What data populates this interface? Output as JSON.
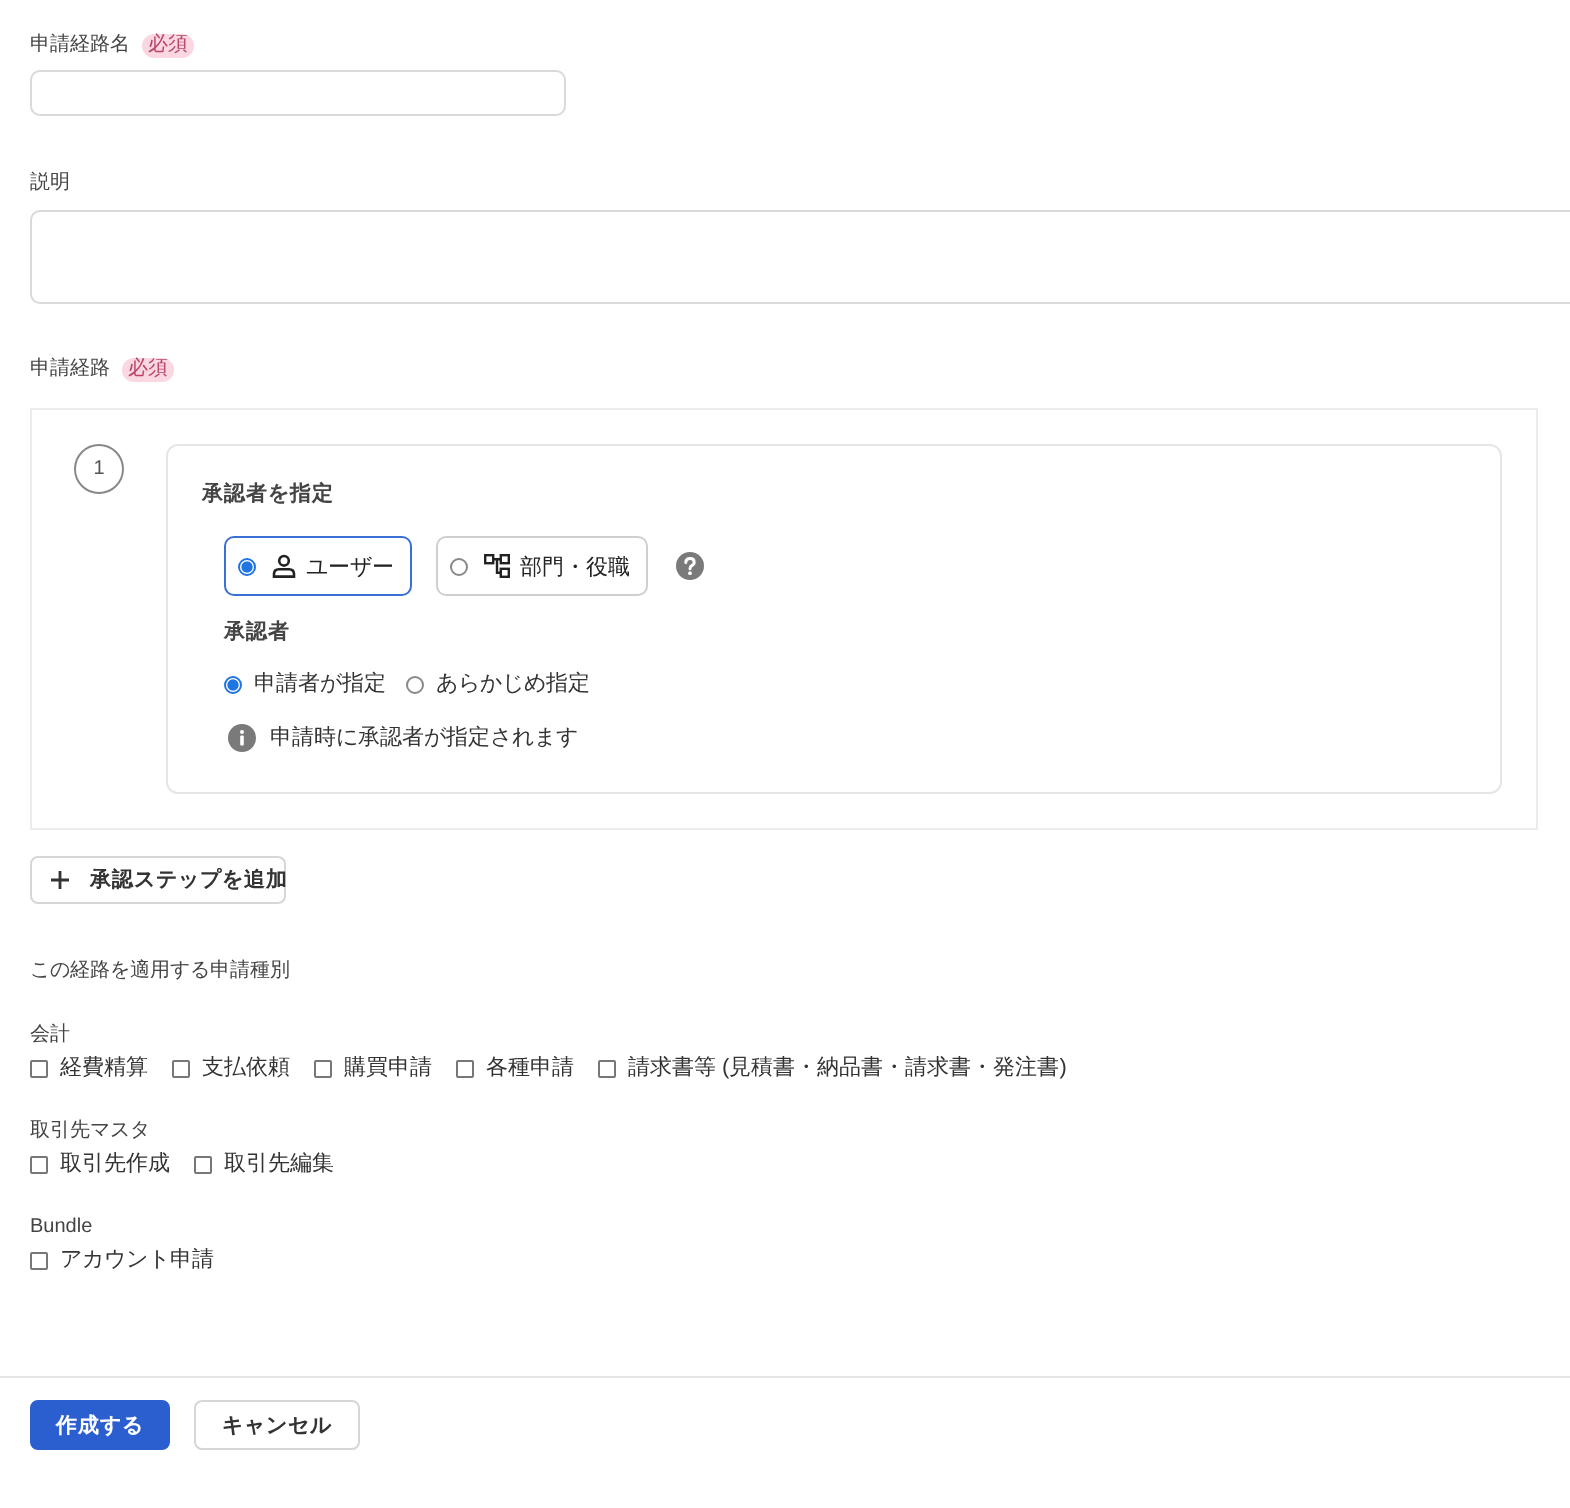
{
  "route_name": {
    "label": "申請経路名",
    "badge": "必須"
  },
  "description": {
    "label": "説明"
  },
  "route": {
    "label": "申請経路",
    "badge": "必須",
    "steps": [
      {
        "number": "1",
        "title": "承認者を指定",
        "approver_types": [
          {
            "kind": "user",
            "label": "ユーザー",
            "selected": true
          },
          {
            "kind": "org",
            "label": "部門・役職",
            "selected": false
          }
        ],
        "approver_label": "承認者",
        "approver_modes": [
          {
            "label": "申請者が指定",
            "selected": true
          },
          {
            "label": "あらかじめ指定",
            "selected": false
          }
        ],
        "info": "申請時に承認者が指定されます"
      }
    ]
  },
  "add_step_button": {
    "label": "承認ステップを追加"
  },
  "request_types": {
    "label": "この経路を適用する申請種別",
    "groups": [
      {
        "label": "会計",
        "options": [
          {
            "label": "経費精算",
            "checked": false
          },
          {
            "label": "支払依頼",
            "checked": false
          },
          {
            "label": "購買申請",
            "checked": false
          },
          {
            "label": "各種申請",
            "checked": false
          },
          {
            "label": "請求書等 (見積書・納品書・請求書・発注書)",
            "checked": false
          }
        ]
      },
      {
        "label": "取引先マスタ",
        "options": [
          {
            "label": "取引先作成",
            "checked": false
          },
          {
            "label": "取引先編集",
            "checked": false
          }
        ]
      },
      {
        "label": "Bundle",
        "options": [
          {
            "label": "アカウント申請",
            "checked": false
          }
        ]
      }
    ]
  },
  "actions": [
    {
      "kind": "primary",
      "label": "作成する"
    },
    {
      "kind": "secondary",
      "label": "キャンセル"
    }
  ]
}
